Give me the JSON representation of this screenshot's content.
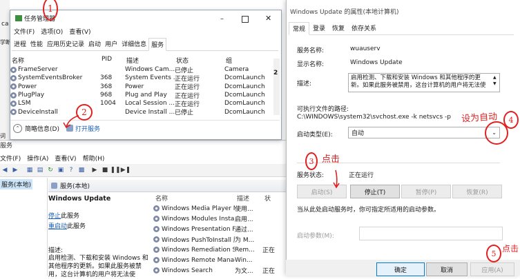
{
  "bg_left": {
    "text1": "ca",
    "text2": "学断",
    "text3": "词",
    "text4": "服务"
  },
  "task_manager": {
    "title": "任务管理器",
    "menu": [
      "文件(F)",
      "选项(O)",
      "查看(V)"
    ],
    "tabs": [
      "进程",
      "性能",
      "应用历史记录",
      "启动",
      "用户",
      "详细信息",
      "服务"
    ],
    "active_tab": "服务",
    "columns": [
      "名称",
      "PID",
      "描述",
      "状态",
      "组"
    ],
    "rows": [
      [
        "FrameServer",
        "",
        "Windows Cam...",
        "已停止",
        "Camera"
      ],
      [
        "SystemEventsBroker",
        "368",
        "System Events ...",
        "正在运行",
        "DcomLaunch"
      ],
      [
        "Power",
        "368",
        "Power",
        "正在运行",
        "DcomLaunch"
      ],
      [
        "PlugPlay",
        "968",
        "Plug and Play",
        "正在运行",
        "DcomLaunch"
      ],
      [
        "LSM",
        "1004",
        "Local Session ...",
        "正在运行",
        "DcomLaunch"
      ],
      [
        "DeviceInstall",
        "",
        "Device Install ...",
        "已停止",
        "DcomLaunch"
      ]
    ],
    "footer_brief": "简略信息(D)",
    "footer_open_services": "打开服务",
    "right_edge_text": "2"
  },
  "services": {
    "title": "服务",
    "menu": [
      "文件(F)",
      "操作(A)",
      "查看(V)",
      "帮助(H)"
    ],
    "tree_item": "服务(本地)",
    "header": "服务(本地)",
    "detail_title": "Windows Update",
    "stop_link": "停止",
    "stop_suffix": "此服务",
    "restart_link": "重启动",
    "restart_suffix": "此服务",
    "desc_label": "描述:",
    "desc_text": "启用检测、下载和安装 Windows 和其他程序的更新。如果此服务被禁用，这台计算机的用户将无法使",
    "list_header": {
      "name": "名称",
      "desc": "描述",
      "status": "状"
    },
    "list": [
      [
        "Windows Media Player Net...",
        "使用...",
        ""
      ],
      [
        "Windows Modules Installer",
        "启用...",
        ""
      ],
      [
        "Windows Presentation Fo...",
        "通过...",
        ""
      ],
      [
        "Windows PushToInstall 服务",
        "为 M...",
        ""
      ],
      [
        "Windows Remediation Ser...",
        "Rem...",
        "正在"
      ],
      [
        "Windows Remote Manage...",
        "Win...",
        ""
      ],
      [
        "Windows Search",
        "为文...",
        "正在"
      ]
    ]
  },
  "properties": {
    "title": "Windows Update 的属性(本地计算机)",
    "tabs": [
      "常规",
      "登录",
      "恢复",
      "依存关系"
    ],
    "service_name_label": "服务名称:",
    "service_name": "wuauserv",
    "display_name_label": "显示名称:",
    "display_name": "Windows Update",
    "desc_label": "描述:",
    "desc_text": "启用检测、下载和安装 Windows 和其他程序的更新。如果此服务被禁用，这台计算机的用户将无法使",
    "path_label": "可执行文件的路径:",
    "path": "C:\\WINDOWS\\system32\\svchost.exe -k netsvcs -p",
    "startup_label": "启动类型(E):",
    "startup_value": "自动",
    "status_label": "服务状态:",
    "status_value": "正在运行",
    "buttons": {
      "start": "启动(S)",
      "stop": "停止(T)",
      "pause": "暂停(P)",
      "resume": "恢复(R)"
    },
    "hint": "当从此处启动服务时，你可指定所适用的启动参数。",
    "params_label": "启动参数(M):",
    "ok": "确定",
    "cancel": "取消",
    "apply": "应用(A)"
  },
  "annotations": {
    "a1": "1",
    "a2": "2",
    "a3_num": "3",
    "a3_text": "点击",
    "a4_num": "4",
    "a4_text": "设为自动",
    "a5_num": "5",
    "a5_text": "点击"
  }
}
